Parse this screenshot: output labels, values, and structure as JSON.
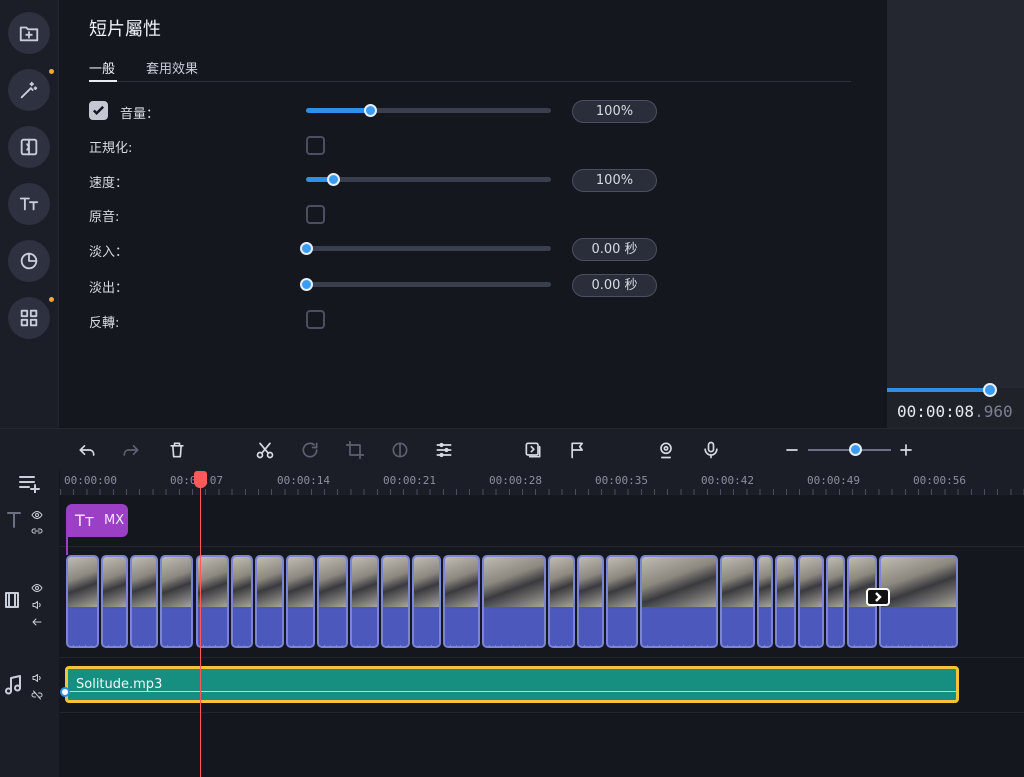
{
  "rail": {
    "items": [
      {
        "name": "import"
      },
      {
        "name": "magic-wand",
        "dot": true
      },
      {
        "name": "transitions"
      },
      {
        "name": "titles"
      },
      {
        "name": "stickers"
      },
      {
        "name": "more",
        "dot": true
      }
    ]
  },
  "properties": {
    "title": "短片屬性",
    "tabs": [
      "一般",
      "套用效果"
    ],
    "rows": {
      "volume": {
        "label": "音量：",
        "value": "100%",
        "checked": true,
        "level": 0.26
      },
      "normalize": {
        "label": "正規化:",
        "checked": false
      },
      "speed": {
        "label": "速度：",
        "value": "100%",
        "level": 0.11
      },
      "original_sound": {
        "label": "原音:",
        "checked": false
      },
      "fade_in": {
        "label": "淡入：",
        "value": "0.00 秒",
        "level": 0
      },
      "fade_out": {
        "label": "淡出：",
        "value": "0.00 秒",
        "level": 0
      },
      "reverse": {
        "label": "反轉:",
        "checked": false
      }
    }
  },
  "preview": {
    "time_main": "00:00:08",
    "time_frac": ".960",
    "progress": 0.75
  },
  "ruler": {
    "labels": [
      "00:00:00",
      "00:00:07",
      "00:00:14",
      "00:00:21",
      "00:00:28",
      "00:00:35",
      "00:00:42",
      "00:00:49",
      "00:00:56"
    ]
  },
  "timeline": {
    "text_clip_label": "MX",
    "text_clip_icon": "Tт",
    "audio_clip_label": "Solitude.mp3"
  },
  "colors": {
    "accent": "#2d8fe8",
    "playhead": "#ff5a5a",
    "text_clip": "#9b3fc4",
    "audio_clip": "#168f80",
    "audio_border": "#f2c537",
    "video_clip": "#4a56b8"
  }
}
